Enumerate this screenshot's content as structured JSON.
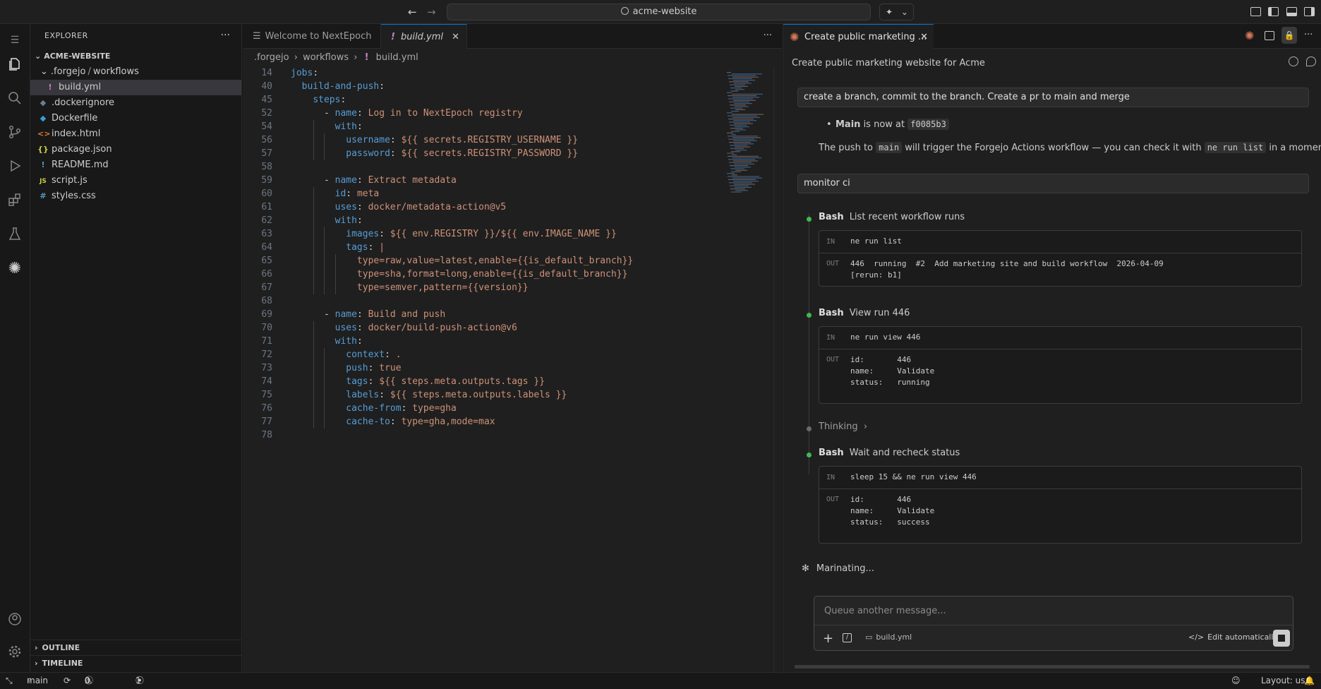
{
  "titlebar": {
    "back_icon": "arrow-left-icon",
    "forward_icon": "arrow-right-icon",
    "search_text": "acme-website"
  },
  "activity": [
    "files-icon",
    "search-icon",
    "source-control-icon",
    "run-debug-icon",
    "extensions-icon",
    "testing-icon",
    "assistant-icon",
    "account-icon",
    "gear-icon"
  ],
  "explorer": {
    "title": "EXPLORER",
    "root": "ACME-WEBSITE",
    "folder_a": ".forgejo",
    "folder_sep": "/",
    "folder_b": "workflows",
    "files": [
      {
        "icon": "!",
        "name": "build.yml"
      },
      {
        "icon": "◆",
        "name": ".dockerignore"
      },
      {
        "icon": "◆",
        "name": "Dockerfile"
      },
      {
        "icon": "<>",
        "name": "index.html"
      },
      {
        "icon": "{}",
        "name": "package.json"
      },
      {
        "icon": "!",
        "name": "README.md"
      },
      {
        "icon": "JS",
        "name": "script.js"
      },
      {
        "icon": "#",
        "name": "styles.css"
      }
    ],
    "outline": "OUTLINE",
    "timeline": "TIMELINE"
  },
  "editor": {
    "tabs": [
      {
        "label": "Welcome to NextEpoch"
      },
      {
        "label": "build.yml"
      }
    ],
    "breadcrumb": [
      ".forgejo",
      "workflows",
      "build.yml"
    ],
    "lines": [
      {
        "n": "14",
        "indent": 0,
        "key": "jobs",
        "val": ""
      },
      {
        "n": "40",
        "indent": 2,
        "key": "build-and-push",
        "val": ""
      },
      {
        "n": "45",
        "indent": 4,
        "key": "steps",
        "val": ""
      },
      {
        "n": "52",
        "indent": 6,
        "dash": true,
        "key": "name",
        "val": "Log in to NextEpoch registry"
      },
      {
        "n": "54",
        "indent": 8,
        "key": "with",
        "val": ""
      },
      {
        "n": "56",
        "indent": 10,
        "key": "username",
        "val": "${{ secrets.REGISTRY_USERNAME }}"
      },
      {
        "n": "57",
        "indent": 10,
        "key": "password",
        "val": "${{ secrets.REGISTRY_PASSWORD }}"
      },
      {
        "n": "58",
        "indent": 0,
        "key": "",
        "val": ""
      },
      {
        "n": "59",
        "indent": 6,
        "dash": true,
        "key": "name",
        "val": "Extract metadata"
      },
      {
        "n": "60",
        "indent": 8,
        "key": "id",
        "val": "meta"
      },
      {
        "n": "61",
        "indent": 8,
        "key": "uses",
        "val": "docker/metadata-action@v5"
      },
      {
        "n": "62",
        "indent": 8,
        "key": "with",
        "val": ""
      },
      {
        "n": "63",
        "indent": 10,
        "key": "images",
        "val": "${{ env.REGISTRY }}/${{ env.IMAGE_NAME }}"
      },
      {
        "n": "64",
        "indent": 10,
        "key": "tags",
        "val": "|"
      },
      {
        "n": "65",
        "indent": 12,
        "key": "",
        "val": "type=raw,value=latest,enable={{is_default_branch}}"
      },
      {
        "n": "66",
        "indent": 12,
        "key": "",
        "val": "type=sha,format=long,enable={{is_default_branch}}"
      },
      {
        "n": "67",
        "indent": 12,
        "key": "",
        "val": "type=semver,pattern={{version}}"
      },
      {
        "n": "68",
        "indent": 0,
        "key": "",
        "val": ""
      },
      {
        "n": "69",
        "indent": 6,
        "dash": true,
        "key": "name",
        "val": "Build and push"
      },
      {
        "n": "70",
        "indent": 8,
        "key": "uses",
        "val": "docker/build-push-action@v6"
      },
      {
        "n": "71",
        "indent": 8,
        "key": "with",
        "val": ""
      },
      {
        "n": "72",
        "indent": 10,
        "key": "context",
        "val": "."
      },
      {
        "n": "73",
        "indent": 10,
        "key": "push",
        "val": "true"
      },
      {
        "n": "74",
        "indent": 10,
        "key": "tags",
        "val": "${{ steps.meta.outputs.tags }}"
      },
      {
        "n": "75",
        "indent": 10,
        "key": "labels",
        "val": "${{ steps.meta.outputs.labels }}"
      },
      {
        "n": "76",
        "indent": 10,
        "key": "cache-from",
        "val": "type=gha"
      },
      {
        "n": "77",
        "indent": 10,
        "key": "cache-to",
        "val": "type=gha,mode=max"
      },
      {
        "n": "78",
        "indent": 0,
        "key": "",
        "val": ""
      }
    ]
  },
  "chat": {
    "tab_label": "Create public marketing ...",
    "title": "Create public marketing website for Acme",
    "msg1": "create a branch, commit to the branch. Create a pr to main and merge",
    "main_label": "Main",
    "main_mid": "is now at",
    "main_sha": "f0085b3",
    "push_pre": "The push to",
    "push_branch": "main",
    "push_mid": "will trigger the Forgejo Actions workflow — you can check it with",
    "push_cmd": "ne run list",
    "push_post": "in a moment.",
    "msg2": "monitor ci",
    "tools": [
      {
        "name": "Bash",
        "desc": "List recent workflow runs",
        "in": "ne run list",
        "out": "446  running  #2  Add marketing site and build workflow  2026-04-09\n[rerun: b1]"
      },
      {
        "name": "Bash",
        "desc": "View run 446",
        "in": "ne run view 446",
        "out": "id:       446\nname:     Validate\nstatus:   running"
      },
      {
        "name": "Bash",
        "desc": "Wait and recheck status",
        "in": "sleep 15 && ne run view 446",
        "out": "id:       446\nname:     Validate\nstatus:   success"
      }
    ],
    "in_label": "IN",
    "out_label": "OUT",
    "thinking": "Thinking",
    "status": "Marinating...",
    "composer_placeholder": "Queue another message...",
    "attachment": "build.yml",
    "edit_mode": "Edit automatically"
  },
  "status": {
    "branch": "main",
    "errors": "0",
    "warnings": "0",
    "ports": "1",
    "layout": "Layout: us"
  },
  "colors": {
    "accent": "#0078d4",
    "key": "#569cd6",
    "string": "#ce9178",
    "success": "#3fb950",
    "brand": "#d97757"
  }
}
